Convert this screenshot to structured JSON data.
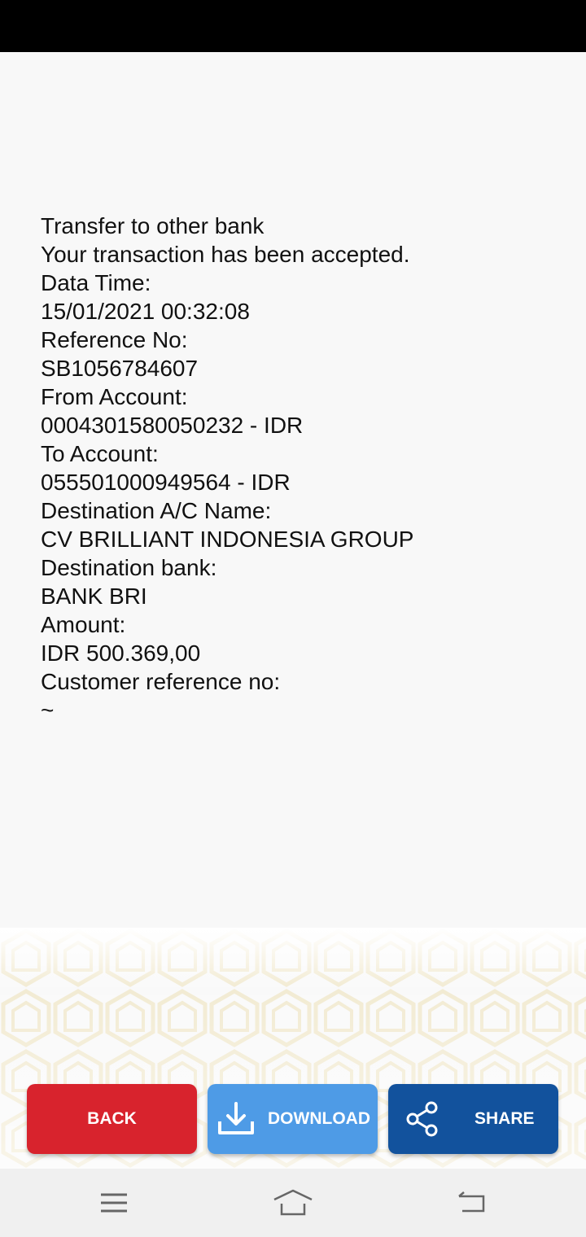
{
  "receipt": {
    "lines": [
      "Transfer to other bank",
      "Your transaction has been accepted.",
      "Data Time:",
      "15/01/2021 00:32:08",
      "Reference No:",
      "SB1056784607",
      "From Account:",
      "0004301580050232 - IDR",
      "To Account:",
      "055501000949564 - IDR",
      "Destination A/C Name:",
      "CV BRILLIANT INDONESIA GROUP",
      "Destination bank:",
      "BANK BRI",
      "Amount:",
      "IDR 500.369,00",
      "Customer reference no:",
      "~"
    ]
  },
  "actions": {
    "back_label": "BACK",
    "download_label": "DOWNLOAD",
    "share_label": "SHARE"
  },
  "icons": {
    "download": "download-icon",
    "share": "share-icon",
    "nav_menu": "menu-icon",
    "nav_home": "home-icon",
    "nav_back": "back-icon"
  },
  "colors": {
    "back_button": "#d8232d",
    "download_button": "#4e9be6",
    "share_button": "#12529d",
    "pattern": "#efe6c8"
  }
}
